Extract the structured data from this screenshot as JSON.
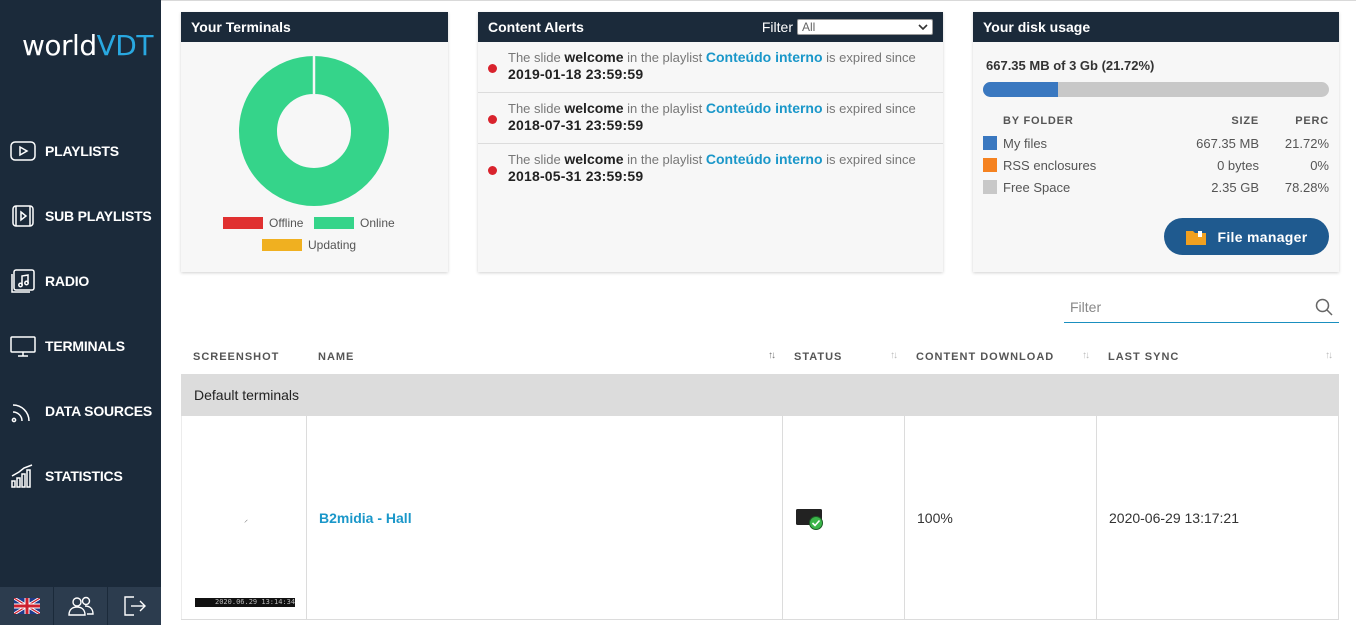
{
  "brand": {
    "logo_text": "world",
    "logo_accent": "VDT"
  },
  "nav": [
    {
      "label": "PLAYLISTS",
      "icon": "play-rect-icon"
    },
    {
      "label": "SUB PLAYLISTS",
      "icon": "sub-playlist-icon"
    },
    {
      "label": "RADIO",
      "icon": "music-note-icon"
    },
    {
      "label": "TERMINALS",
      "icon": "monitor-icon"
    },
    {
      "label": "DATA SOURCES",
      "icon": "rss-icon"
    },
    {
      "label": "STATISTICS",
      "icon": "bar-chart-icon"
    }
  ],
  "bottom": {
    "language_icon": "uk-flag-icon",
    "users_icon": "users-icon",
    "logout_icon": "logout-icon"
  },
  "terminals_card": {
    "title": "Your Terminals",
    "legend": {
      "offline": "Offline",
      "online": "Online",
      "updating": "Updating"
    },
    "colors": {
      "offline": "#e03030",
      "online": "#35d48a",
      "updating": "#f0b020"
    },
    "online_fraction": 1.0
  },
  "alerts_card": {
    "title": "Content Alerts",
    "filter_label": "Filter",
    "filter_value": "All",
    "alerts": [
      {
        "pre": "The slide ",
        "slide": "welcome",
        "mid": " in the playlist ",
        "playlist": "Conteúdo interno",
        "post": " is expired since",
        "date": "2019-01-18 23:59:59"
      },
      {
        "pre": "The slide ",
        "slide": "welcome",
        "mid": " in the playlist ",
        "playlist": "Conteúdo interno",
        "post": " is expired since",
        "date": "2018-07-31 23:59:59"
      },
      {
        "pre": "The slide ",
        "slide": "welcome",
        "mid": " in the playlist ",
        "playlist": "Conteúdo interno",
        "post": " is expired since",
        "date": "2018-05-31 23:59:59"
      }
    ]
  },
  "disk_card": {
    "title": "Your disk usage",
    "total": "667.35 MB of 3 Gb (21.72%)",
    "used_percent": 21.72,
    "headers": {
      "folder": "BY FOLDER",
      "size": "SIZE",
      "perc": "PERC"
    },
    "rows": [
      {
        "name": "My files",
        "size": "667.35 MB",
        "perc": "21.72%",
        "color": "#3a78c0"
      },
      {
        "name": "RSS enclosures",
        "size": "0 bytes",
        "perc": "0%",
        "color": "#f58220"
      },
      {
        "name": "Free Space",
        "size": "2.35 GB",
        "perc": "78.28%",
        "color": "#c8c8c8"
      }
    ],
    "button": "File manager"
  },
  "table": {
    "filter_placeholder": "Filter",
    "headers": {
      "screenshot": "SCREENSHOT",
      "name": "NAME",
      "status": "STATUS",
      "download": "CONTENT DOWNLOAD",
      "sync": "LAST SYNC"
    },
    "sort_glyph": "↑↓",
    "group": "Default terminals",
    "rows": [
      {
        "screenshot_stamp": "2020.06.29 13:14:34",
        "name": "B2midia - Hall",
        "status_icon": "terminal-online-icon",
        "download": "100%",
        "last_sync": "2020-06-29 13:17:21"
      }
    ]
  }
}
